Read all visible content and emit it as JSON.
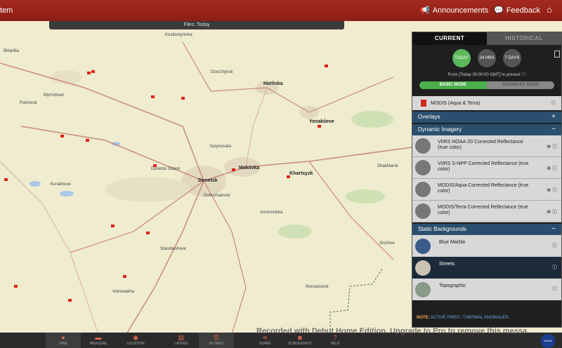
{
  "app": {
    "title": "tem"
  },
  "nav": {
    "announcements": "Announcements",
    "feedback": "Feedback"
  },
  "map": {
    "files_label": "Files: Today",
    "cities": [
      {
        "name": "Horlivka",
        "big": true
      },
      {
        "name": "Yenakiieve",
        "big": true
      },
      {
        "name": "Makiivka",
        "big": true
      },
      {
        "name": "Donetsk",
        "big": true
      },
      {
        "name": "Khartsyzk",
        "big": true
      },
      {
        "name": "Myrnohrad",
        "big": false
      },
      {
        "name": "Pokrovsk",
        "big": false
      },
      {
        "name": "Kostiantynivka",
        "big": false
      },
      {
        "name": "Dzerzhynsk",
        "big": false
      },
      {
        "name": "Yasynuvata",
        "big": false
      },
      {
        "name": "Donetsk Oblast",
        "big": false
      },
      {
        "name": "Kurakhove",
        "big": false
      },
      {
        "name": "Volnovakha",
        "big": false
      },
      {
        "name": "Shakhtarsk",
        "big": false
      },
      {
        "name": "Snizhne",
        "big": false
      },
      {
        "name": "Amvrosiivka",
        "big": false
      },
      {
        "name": "Novoazovsk",
        "big": false
      },
      {
        "name": "Starobesheve",
        "big": false
      },
      {
        "name": "Dokuchaievsk",
        "big": false
      },
      {
        "name": "Bilopillia",
        "big": false
      }
    ]
  },
  "panel": {
    "tabs": {
      "current": "CURRENT",
      "historical": "HISTORICAL"
    },
    "dates": [
      {
        "label": "TODAY"
      },
      {
        "label": "24 HRS"
      },
      {
        "label": "7 DAYS"
      }
    ],
    "range_text": "From [Today 00:00:00 GMT] to present",
    "modes": {
      "basic": "BASIC MODE",
      "advanced": "ADVANCED MODE"
    },
    "modis_row": "MODIS (Aqua & Terra)",
    "overlays_label": "Overlays",
    "dynamic_label": "Dynamic Imagery",
    "dynamic_layers": [
      {
        "name": "VIIRS NOAA-20 Corrected Reflectance (true color)"
      },
      {
        "name": "VIIRS S-NPP Corrected Reflectance (true color)"
      },
      {
        "name": "MODIS/Aqua Corrected Reflectance (true color)"
      },
      {
        "name": "MODIS/Terra Corrected Reflectance (true color)"
      }
    ],
    "static_label": "Static Backgrounds",
    "backgrounds": [
      {
        "name": "Blue Marble"
      },
      {
        "name": "Streets"
      },
      {
        "name": "Topographic"
      }
    ],
    "note_prefix": "NOTE:",
    "note_text": "ACTIVE FIRES / THERMAL ANOMALIES"
  },
  "toolbar": {
    "items": [
      {
        "label": "FIRE"
      },
      {
        "label": "MEASURE"
      },
      {
        "label": "LOCATION"
      },
      {
        "label": "LAYERS"
      },
      {
        "label": "FILTERS"
      },
      {
        "label": "SHARE"
      },
      {
        "label": "SCREENSHOT"
      },
      {
        "label": "HELP"
      }
    ]
  },
  "watermark": "Recorded with Debut Home Edition. Upgrade to Pro to remove this messa",
  "logo": "NASA"
}
